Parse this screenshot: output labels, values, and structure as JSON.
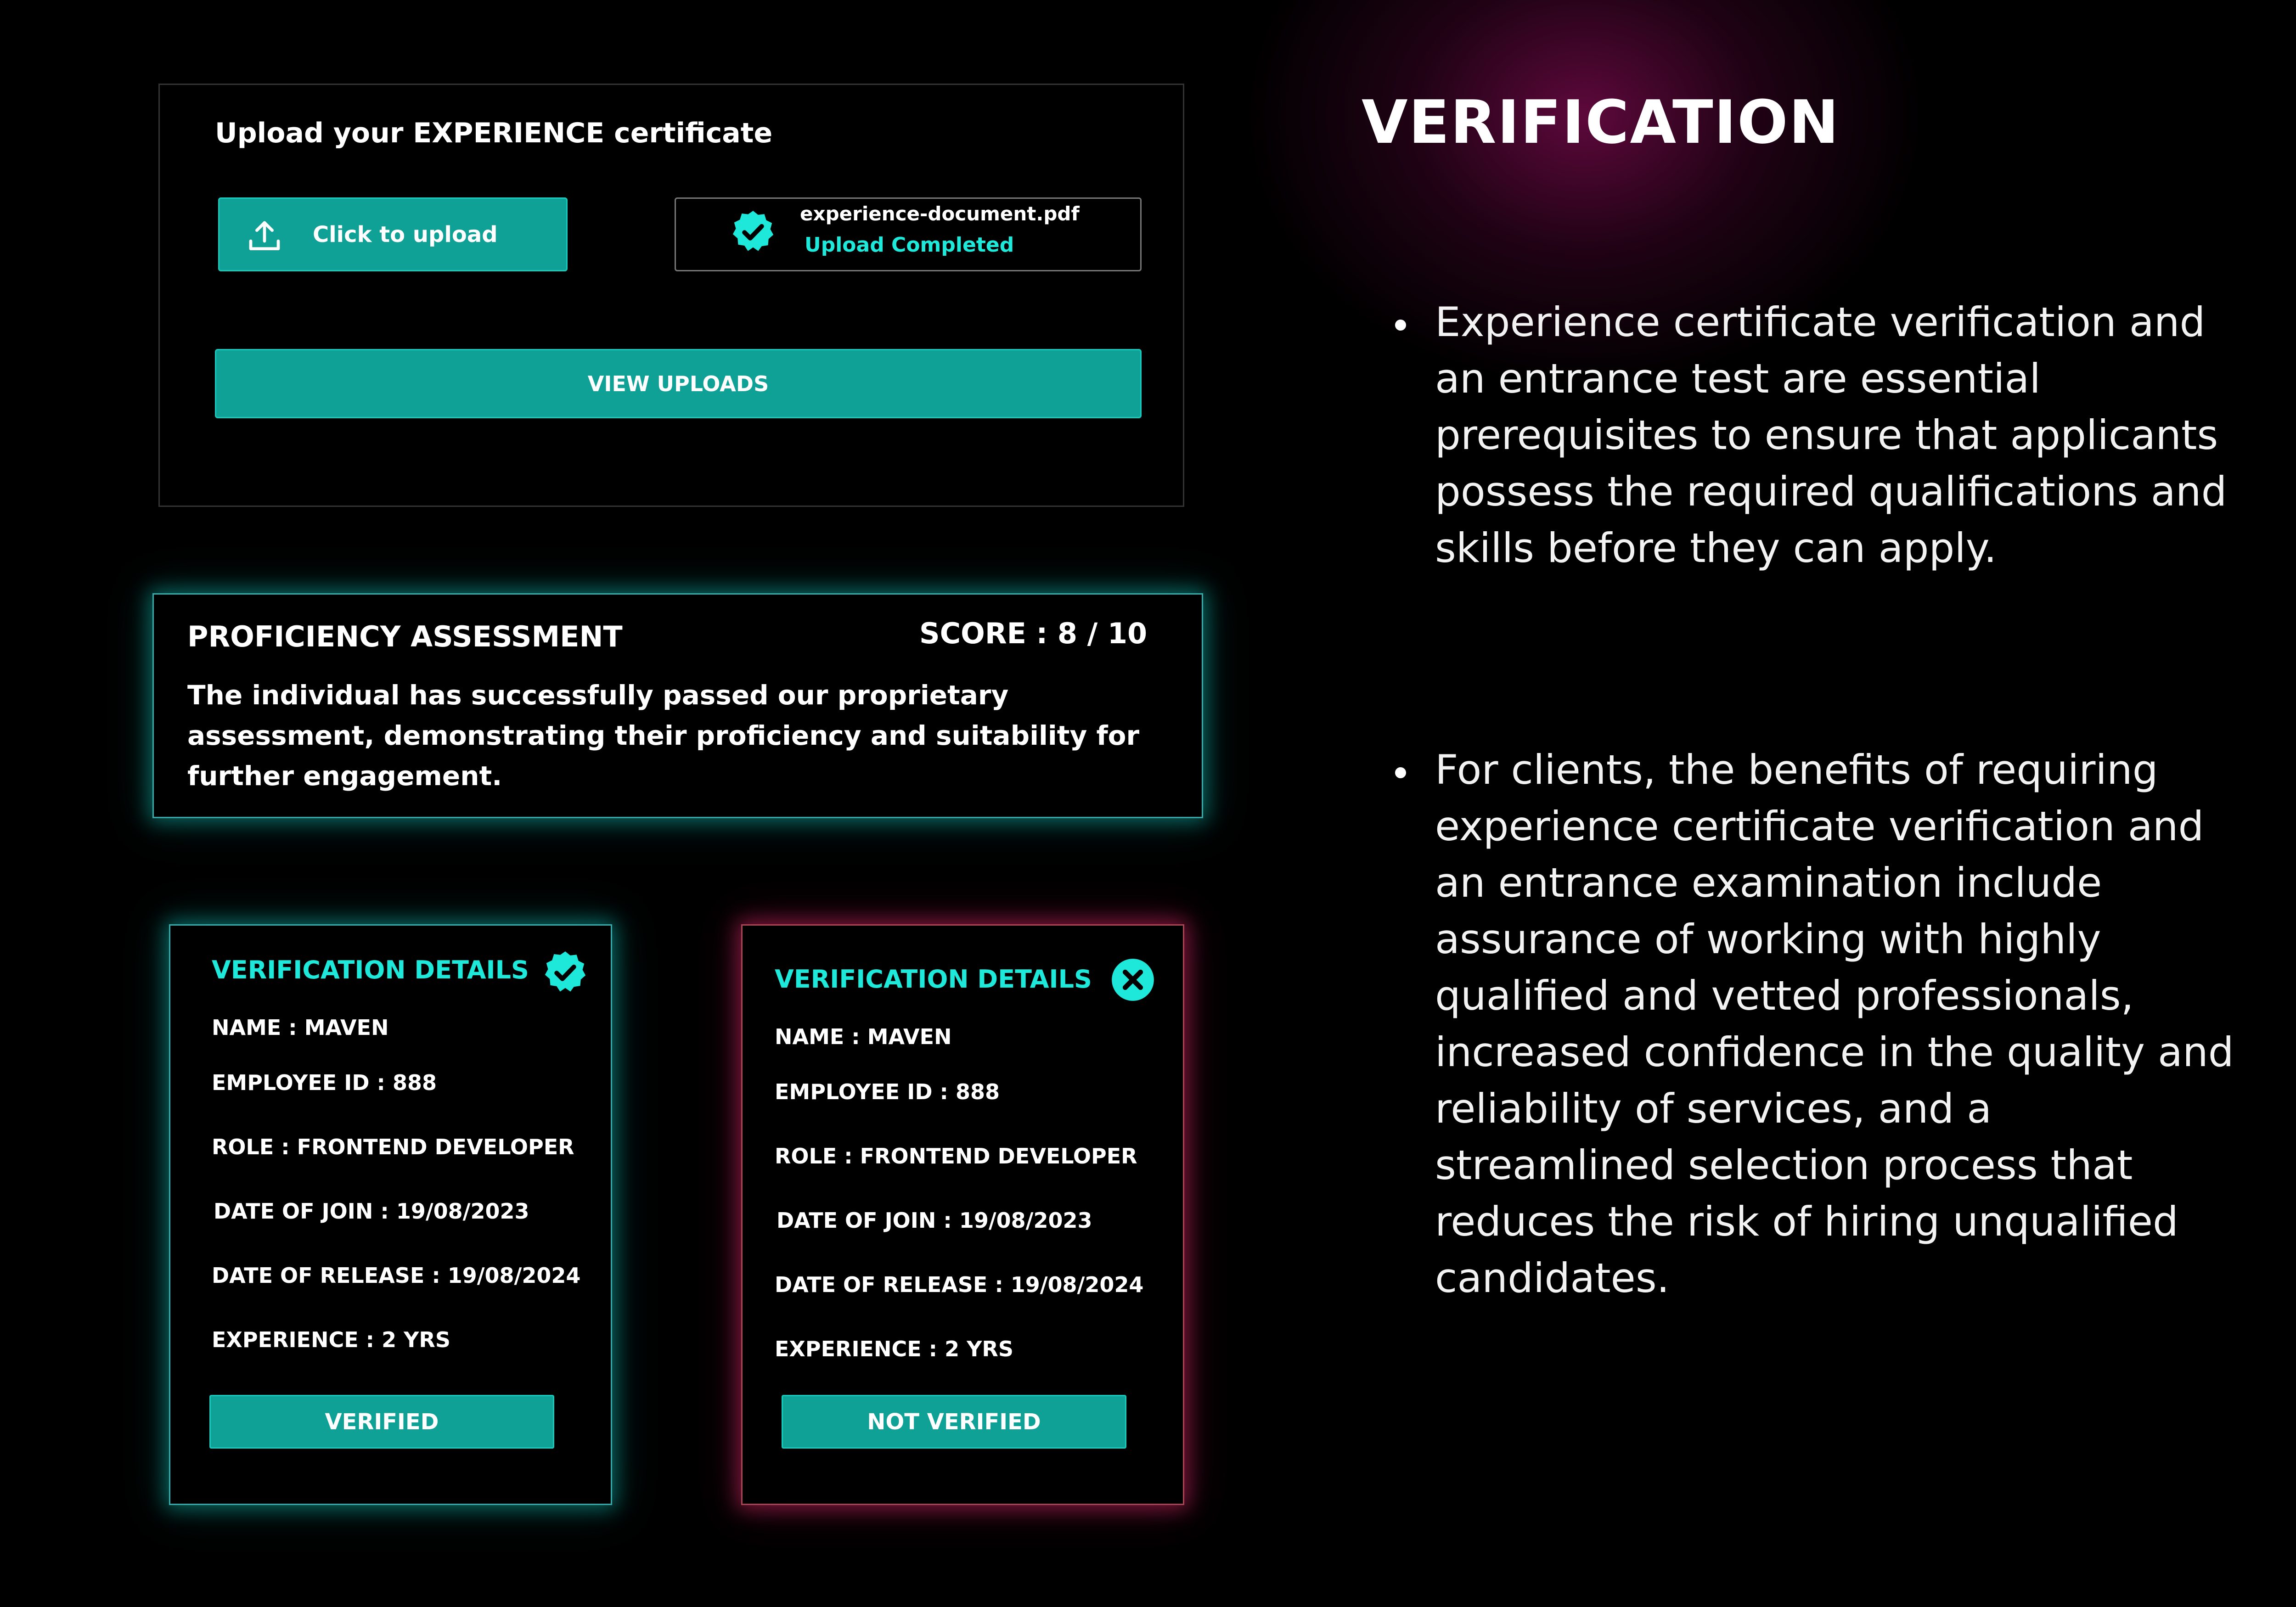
{
  "upload": {
    "title": "Upload your EXPERIENCE certificate",
    "upload_button_label": "Click to upload",
    "file_name": "experience-document.pdf",
    "file_status": "Upload Completed",
    "view_uploads_label": "VIEW UPLOADS"
  },
  "proficiency": {
    "title": "PROFICIENCY ASSESSMENT",
    "score": "SCORE : 8 / 10",
    "description": "The individual has successfully passed our proprietary assessment, demonstrating their proficiency and suitability for further engagement."
  },
  "cards": {
    "verified": {
      "title": "VERIFICATION DETAILS",
      "name": "NAME : MAVEN",
      "employee_id": "EMPLOYEE ID : 888",
      "role": "ROLE : FRONTEND DEVELOPER",
      "date_of_join": "DATE OF JOIN : 19/08/2023",
      "date_of_release": "DATE OF RELEASE : 19/08/2024",
      "experience": "EXPERIENCE : 2 YRS",
      "status_label": "VERIFIED"
    },
    "not_verified": {
      "title": "VERIFICATION DETAILS",
      "name": "NAME : MAVEN",
      "employee_id": "EMPLOYEE ID : 888",
      "role": "ROLE : FRONTEND DEVELOPER",
      "date_of_join": "DATE OF JOIN : 19/08/2023",
      "date_of_release": "DATE OF RELEASE : 19/08/2024",
      "experience": "EXPERIENCE : 2 YRS",
      "status_label": "NOT VERIFIED"
    }
  },
  "info": {
    "heading": "VERIFICATION",
    "bullets": [
      "Experience certificate verification and an entrance test are essential prerequisites to ensure that applicants possess the required qualifications and skills before they can apply.",
      "For clients, the benefits of requiring experience certificate verification and an entrance examination include assurance of working with highly qualified and vetted professionals, increased confidence in the quality and reliability of services, and a streamlined selection process that reduces the risk of hiring unqualified candidates."
    ]
  },
  "icons": {
    "upload": "upload-icon",
    "verified_badge": "verified-badge-icon",
    "close_circle": "close-circle-icon"
  },
  "colors": {
    "background": "#000000",
    "accent_teal": "#0fa096",
    "teal_text": "#1ee8d9",
    "glow_teal": "#14c8be",
    "glow_pink": "#dc2864",
    "heading_glow": "#6e0a46"
  }
}
